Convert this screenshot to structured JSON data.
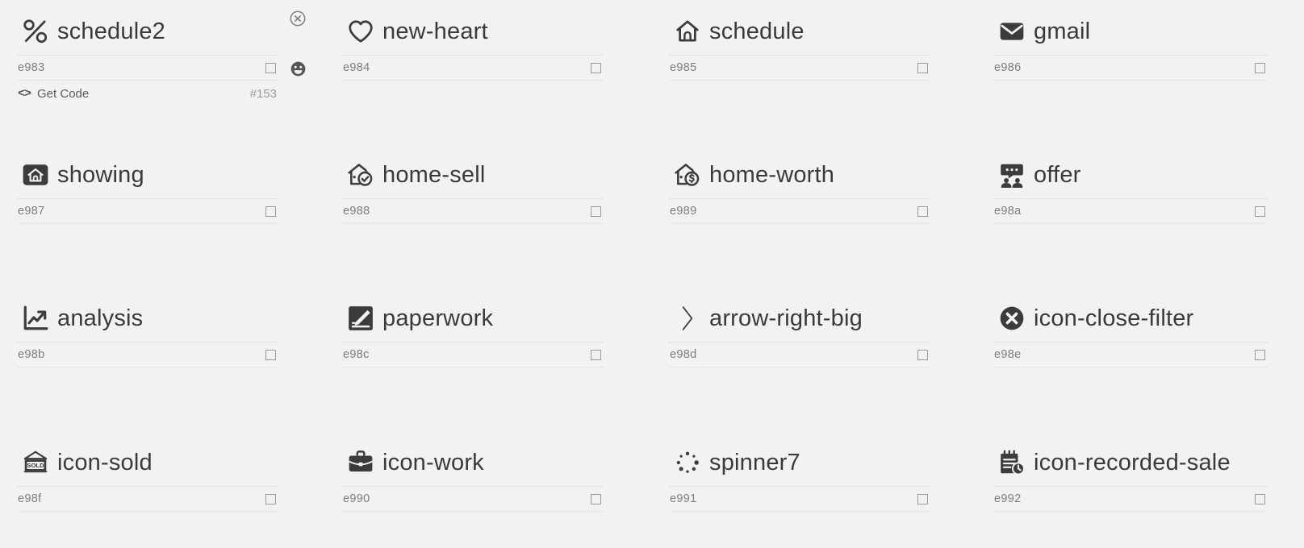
{
  "app": {
    "background_color": "#f2f2f2",
    "icon_color": "#3c3c3c",
    "text_color": "#3a3a3a",
    "muted_color": "#7d7d7d"
  },
  "side_actions": [
    {
      "name": "remove-icon",
      "glyph": "circle-x"
    },
    {
      "name": "emoji-icon",
      "glyph": "smiley-face"
    }
  ],
  "selected_cell": {
    "getcode_label": "Get Code",
    "getcode_number": "#153",
    "getcode_glyph": "<>"
  },
  "icons": [
    {
      "name": "schedule2",
      "code": "e983",
      "glyph": "percent",
      "selected": true
    },
    {
      "name": "new-heart",
      "code": "e984",
      "glyph": "heart-outline",
      "selected": false
    },
    {
      "name": "schedule",
      "code": "e985",
      "glyph": "house-outline",
      "selected": false
    },
    {
      "name": "gmail",
      "code": "e986",
      "glyph": "envelope-filled",
      "selected": false
    },
    {
      "name": "showing",
      "code": "e987",
      "glyph": "house-badge-square",
      "selected": false
    },
    {
      "name": "home-sell",
      "code": "e988",
      "glyph": "house-check",
      "selected": false
    },
    {
      "name": "home-worth",
      "code": "e989",
      "glyph": "house-dollar",
      "selected": false
    },
    {
      "name": "offer",
      "code": "e98a",
      "glyph": "speech-people",
      "selected": false
    },
    {
      "name": "analysis",
      "code": "e98b",
      "glyph": "chart-arrow-up",
      "selected": false
    },
    {
      "name": "paperwork",
      "code": "e98c",
      "glyph": "pen-square",
      "selected": false
    },
    {
      "name": "arrow-right-big",
      "code": "e98d",
      "glyph": "chevron-right-thin",
      "selected": false
    },
    {
      "name": "icon-close-filter",
      "code": "e98e",
      "glyph": "circle-x-filled",
      "selected": false
    },
    {
      "name": "icon-sold",
      "code": "e98f",
      "glyph": "sold-sign",
      "selected": false
    },
    {
      "name": "icon-work",
      "code": "e990",
      "glyph": "briefcase",
      "selected": false
    },
    {
      "name": "spinner7",
      "code": "e991",
      "glyph": "spinner-dots",
      "selected": false
    },
    {
      "name": "icon-recorded-sale",
      "code": "e992",
      "glyph": "calendar-clock",
      "selected": false
    }
  ]
}
